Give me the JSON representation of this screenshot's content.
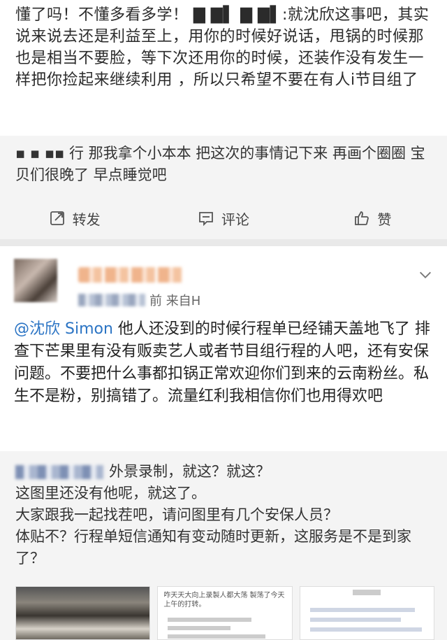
{
  "post": {
    "text": "懂了吗！不懂多看多学！ ▇ ▇▌ ▇ ▇▌:就沈欣这事吧，其实说来说去还是利益至上，用你的时候好说话，甩锅的时候那也是相当不要脸，等下次还用你的时候，还装作没有发生一样把你捡起来继续利用 ，所以只希望不要在有人i节目组了"
  },
  "repost": {
    "text": "▪ ▪  ▪▪ 行 那我拿个小本本 把这次的事情记下来 再画个圈圈 宝贝们很晚了 早点睡觉吧"
  },
  "actions": [
    {
      "label": "转发",
      "icon": "share-icon"
    },
    {
      "label": "评论",
      "icon": "comment-icon"
    },
    {
      "label": "赞",
      "icon": "like-icon"
    }
  ],
  "comment": {
    "meta_prefix": "",
    "meta_suffix": "前 来自H",
    "mention": "@沈欣 Simon",
    "text": " 他人还没到的时候行程单已经铺天盖地飞了 排查下芒果里有没有贩卖艺人或者节目组行程的人吧，还有安保问题。不要把什么事都扣锅正常欢迎你们到来的云南粉丝。私生不是粉，别搞错了。流量红利我相信你们也用得欢吧"
  },
  "repost2": {
    "line1": "外景录制，就这？就这？",
    "line2": "这图里还没有他呢，就这了。",
    "line3": "大家跟我一起找茬吧，请问图里有几个安保人员？",
    "line4": "体贴不？行程单短信通知有变动随时更新，这服务是不是到家了？"
  },
  "thumb2_text": "咋天天大向上录製人都大荡 製荡了今天上午的打转。"
}
